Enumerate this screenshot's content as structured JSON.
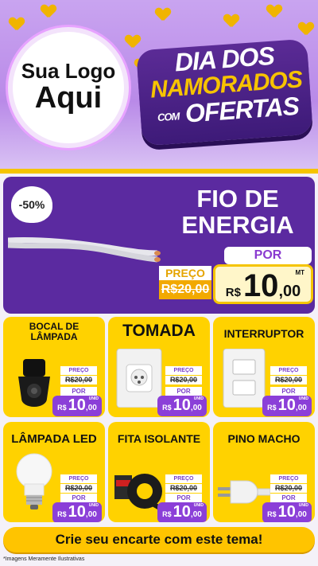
{
  "header": {
    "logo_line1": "Sua Logo",
    "logo_line2": "Aqui",
    "title_line1": "DIA DOS",
    "title_line2": "NAMORADOS",
    "title_line3_small": "COM",
    "title_line3": "OFERTAS"
  },
  "featured": {
    "discount_badge": "-50%",
    "title_line1": "FIO DE",
    "title_line2": "ENERGIA",
    "por_label": "POR",
    "preco_label": "PREÇO",
    "old_price": "R$20,00",
    "currency": "R$",
    "price_int": "10",
    "price_dec": ",00",
    "unit": "MT"
  },
  "products": [
    {
      "title": "BOCAL DE LÂMPADA",
      "icon": "lamp-socket-icon",
      "preco_label": "PREÇO",
      "old_price": "R$20,00",
      "por_label": "POR",
      "currency": "R$",
      "price_int": "10",
      "price_dec": ",00",
      "unit": "UNID"
    },
    {
      "title": "TOMADA",
      "icon": "power-outlet-icon",
      "preco_label": "PREÇO",
      "old_price": "R$20,00",
      "por_label": "POR",
      "currency": "R$",
      "price_int": "10",
      "price_dec": ",00",
      "unit": "UNID"
    },
    {
      "title": "INTERRUPTOR",
      "icon": "light-switch-icon",
      "preco_label": "PREÇO",
      "old_price": "R$20,00",
      "por_label": "POR",
      "currency": "R$",
      "price_int": "10",
      "price_dec": ",00",
      "unit": "UNID"
    },
    {
      "title": "LÂMPADA LED",
      "icon": "led-bulb-icon",
      "preco_label": "PREÇO",
      "old_price": "R$20,00",
      "por_label": "POR",
      "currency": "R$",
      "price_int": "10",
      "price_dec": ",00",
      "unit": "UNID"
    },
    {
      "title": "FITA ISOLANTE",
      "icon": "insulating-tape-icon",
      "preco_label": "PREÇO",
      "old_price": "R$20,00",
      "por_label": "POR",
      "currency": "R$",
      "price_int": "10",
      "price_dec": ",00",
      "unit": "UNID"
    },
    {
      "title": "PINO MACHO",
      "icon": "plug-icon",
      "preco_label": "PREÇO",
      "old_price": "R$20,00",
      "por_label": "POR",
      "currency": "R$",
      "price_int": "10",
      "price_dec": ",00",
      "unit": "UNID"
    }
  ],
  "cta": {
    "label": "Crie seu encarte com este tema!"
  },
  "footnote": "*Imagens Meramente Ilustrativas",
  "colors": {
    "purple": "#5b2aa0",
    "yellow": "#ffd200",
    "accent_purple": "#8b3fd8"
  }
}
